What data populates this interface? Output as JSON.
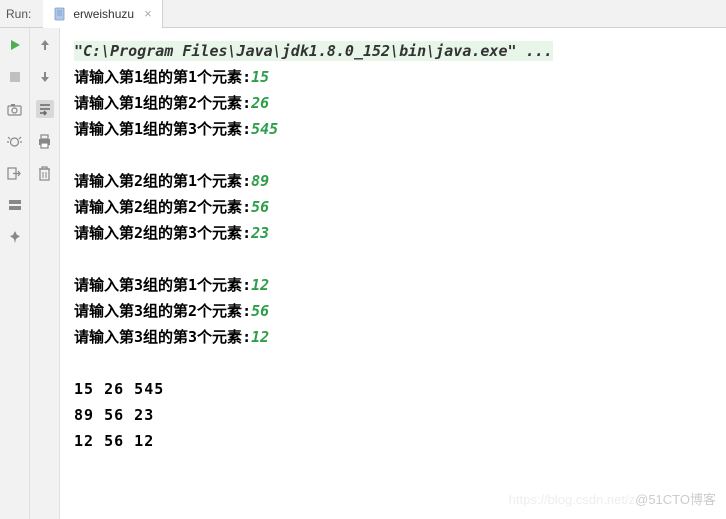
{
  "header": {
    "run_label": "Run:",
    "tab_name": "erweishuzu",
    "tab_close": "×"
  },
  "toolbar_left": {
    "run": "▶",
    "stop": "■",
    "camera": "📷",
    "debug": "🐞",
    "exit": "⎘",
    "layout": "▤",
    "pin": "📌"
  },
  "toolbar_right": {
    "up": "↑",
    "down": "↓",
    "wrap": "⭳",
    "print": "🖶",
    "delete": "🗑"
  },
  "console": {
    "command": "\"C:\\Program Files\\Java\\jdk1.8.0_152\\bin\\java.exe\" ...",
    "groups": [
      {
        "lines": [
          {
            "prompt": "请输入第1组的第1个元素:",
            "value": "15"
          },
          {
            "prompt": "请输入第1组的第2个元素:",
            "value": "26"
          },
          {
            "prompt": "请输入第1组的第3个元素:",
            "value": "545"
          }
        ]
      },
      {
        "lines": [
          {
            "prompt": "请输入第2组的第1个元素:",
            "value": "89"
          },
          {
            "prompt": "请输入第2组的第2个元素:",
            "value": "56"
          },
          {
            "prompt": "请输入第2组的第3个元素:",
            "value": "23"
          }
        ]
      },
      {
        "lines": [
          {
            "prompt": "请输入第3组的第1个元素:",
            "value": "12"
          },
          {
            "prompt": "请输入第3组的第2个元素:",
            "value": "56"
          },
          {
            "prompt": "请输入第3组的第3个元素:",
            "value": "12"
          }
        ]
      }
    ],
    "output": [
      "15 26 545",
      "89 56 23",
      "12 56 12"
    ]
  },
  "watermark": {
    "faint": "https://blog.csdn.net/z",
    "text": "@51CTO博客"
  }
}
